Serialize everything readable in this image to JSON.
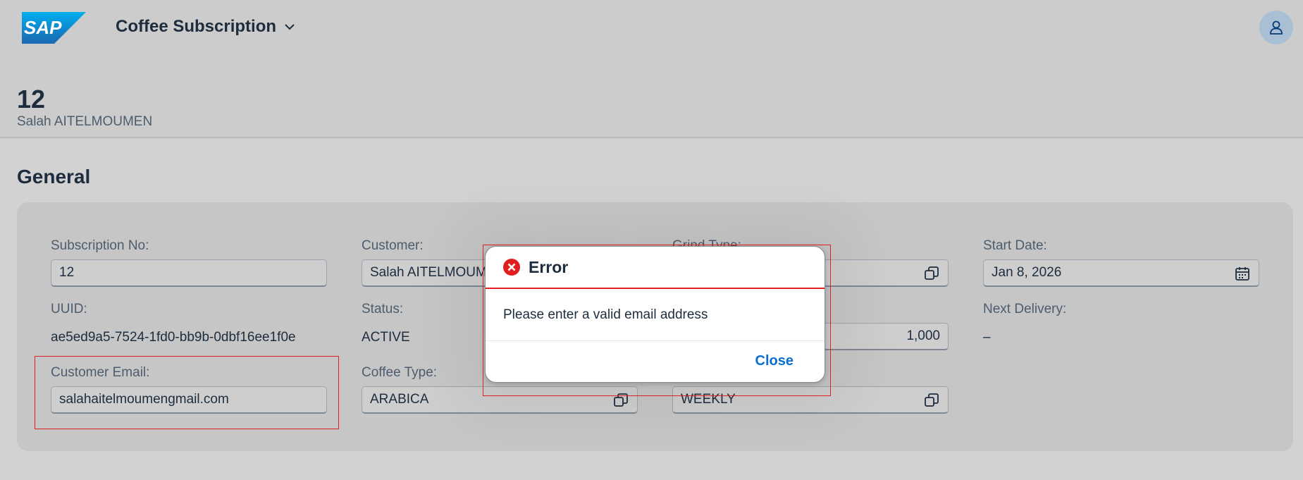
{
  "shell": {
    "logo_text": "SAP",
    "app_title": "Coffee Subscription"
  },
  "object_header": {
    "title": "12",
    "subtitle": "Salah AITELMOUMEN"
  },
  "section": {
    "title": "General"
  },
  "fields": {
    "subscription_no": {
      "label": "Subscription No:",
      "value": "12"
    },
    "uuid": {
      "label": "UUID:",
      "value": "ae5ed9a5-7524-1fd0-bb9b-0dbf16ee1f0e"
    },
    "customer_email": {
      "label": "Customer Email:",
      "value": "salahaitelmoumengmail.com"
    },
    "customer": {
      "label": "Customer:",
      "value": "Salah AITELMOUMEN"
    },
    "status": {
      "label": "Status:",
      "value": "ACTIVE"
    },
    "coffee_type": {
      "label": "Coffee Type:",
      "value": "ARABICA"
    },
    "grind_type": {
      "label": "Grind Type:",
      "value": ""
    },
    "quantity": {
      "value": "1,000"
    },
    "frequency": {
      "value": "WEEKLY"
    },
    "start_date": {
      "label": "Start Date:",
      "value": "Jan 8, 2026"
    },
    "next_delivery": {
      "label": "Next Delivery:",
      "value": "–"
    }
  },
  "dialog": {
    "title": "Error",
    "message": "Please enter a valid email address",
    "close_label": "Close"
  },
  "colors": {
    "error": "#e02020",
    "link": "#0a6ed1",
    "text": "#1d2d3e"
  }
}
